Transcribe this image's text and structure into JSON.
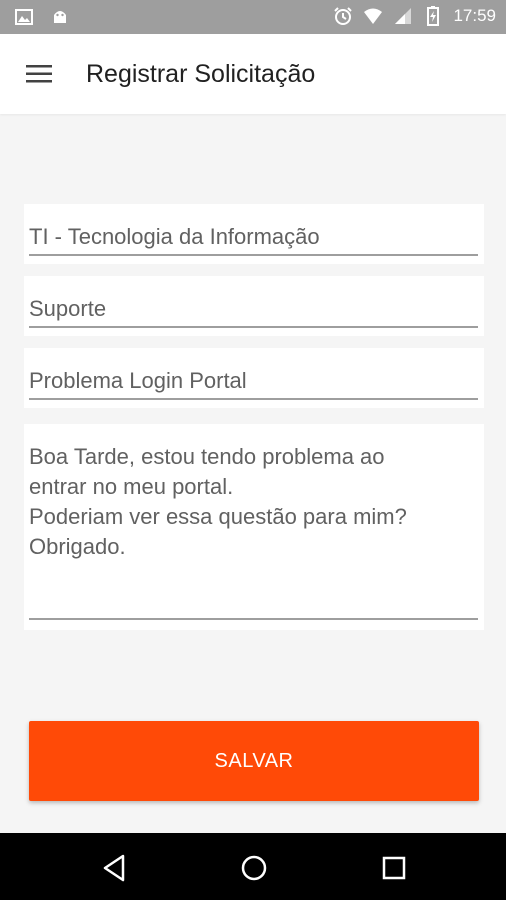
{
  "status_bar": {
    "time": "17:59",
    "left_icons": [
      "image-icon",
      "android-icon"
    ],
    "right_icons": [
      "alarm-icon",
      "wifi-icon",
      "signal-icon",
      "battery-charging-icon"
    ]
  },
  "app_bar": {
    "title": "Registrar Solicitação",
    "menu_icon": "hamburger-menu-icon"
  },
  "form": {
    "department": "TI - Tecnologia da Informação",
    "category": "Suporte",
    "subject": "Problema Login Portal",
    "description": "Boa Tarde, estou tendo problema ao\nentrar no meu portal.\nPoderiam ver essa questão para mim?\nObrigado."
  },
  "actions": {
    "save_label": "SALVAR"
  },
  "colors": {
    "accent": "#ff4a07",
    "status_bar": "#9e9e9e",
    "nav_bar": "#000000"
  },
  "nav_bar": {
    "icons": [
      "back-icon",
      "home-icon",
      "recent-apps-icon"
    ]
  }
}
